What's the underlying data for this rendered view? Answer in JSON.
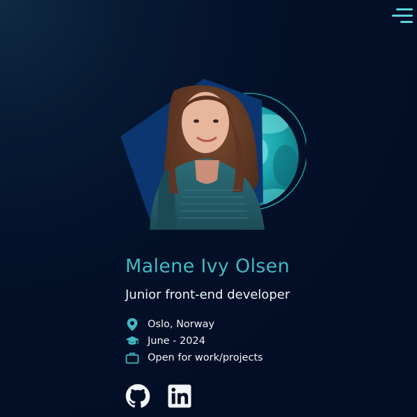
{
  "profile": {
    "name": "Malene Ivy Olsen",
    "role": "Junior front-end developer",
    "details": [
      {
        "icon": "location-pin-icon",
        "text": "Oslo, Norway"
      },
      {
        "icon": "graduation-cap-icon",
        "text": "June - 2024"
      },
      {
        "icon": "briefcase-icon",
        "text": "Open for work/projects"
      }
    ]
  },
  "social": [
    {
      "icon": "github-icon"
    },
    {
      "icon": "linkedin-icon"
    }
  ],
  "nav": {
    "menu_icon": "menu-icon"
  },
  "colors": {
    "background": "#020c22",
    "accent": "#43b8c2",
    "text": "#f2f5f8",
    "pentagon": "#0b3670",
    "planet": "#1aa7ad"
  }
}
